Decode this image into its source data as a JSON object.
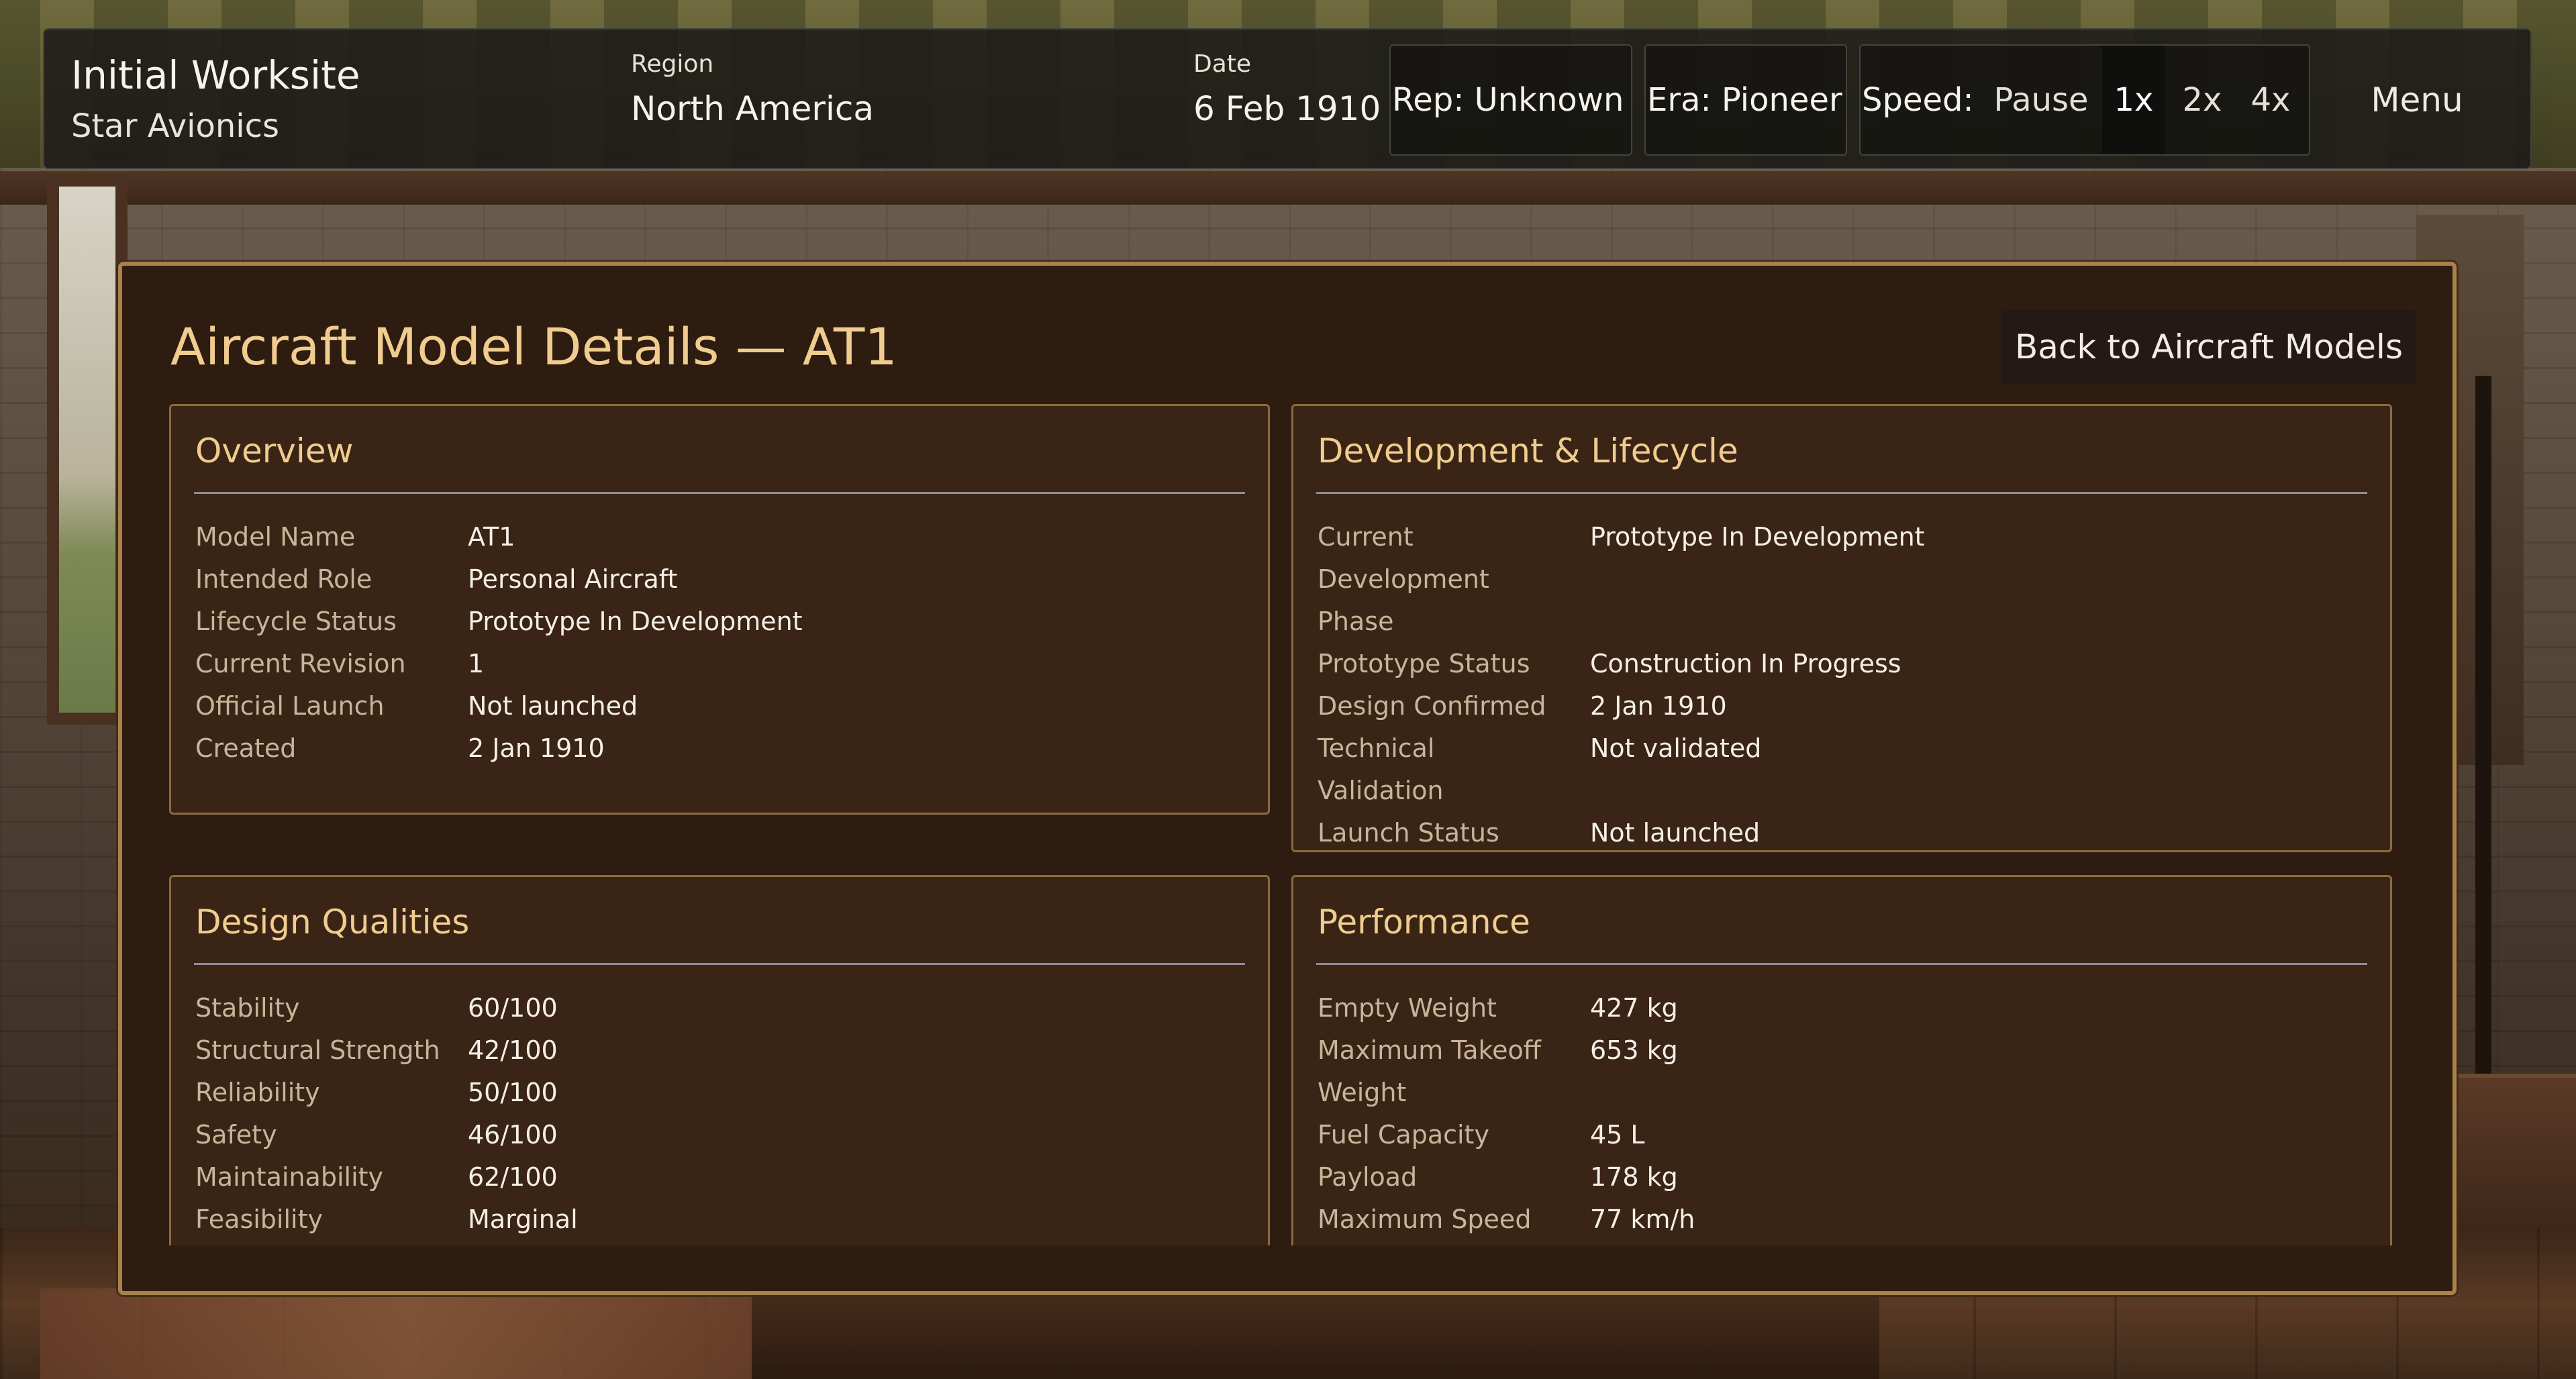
{
  "hud": {
    "company_title": "Initial Worksite",
    "company_sub": "Star Avionics",
    "region_label": "Region",
    "region_value": "North America",
    "date_label": "Date",
    "date_value": "6 Feb 1910",
    "rep": "Rep: Unknown",
    "era": "Era: Pioneer",
    "speed_label": "Speed:",
    "speed_options": [
      "Pause",
      "1x",
      "2x",
      "4x"
    ],
    "speed_active": "1x",
    "menu": "Menu"
  },
  "panel": {
    "title": "Aircraft Model Details — AT1",
    "back_button": "Back to Aircraft Models"
  },
  "cards": {
    "overview": {
      "title": "Overview",
      "rows": [
        {
          "k": "Model Name",
          "v": "AT1"
        },
        {
          "k": "Intended Role",
          "v": "Personal Aircraft"
        },
        {
          "k": "Lifecycle Status",
          "v": "Prototype In Development"
        },
        {
          "k": "Current Revision",
          "v": "1"
        },
        {
          "k": "Official Launch",
          "v": "Not launched"
        },
        {
          "k": "Created",
          "v": "2 Jan 1910"
        }
      ]
    },
    "development": {
      "title": "Development & Lifecycle",
      "rows": [
        {
          "k": "Current Development Phase",
          "v": "Prototype In Development"
        },
        {
          "k": "Prototype Status",
          "v": "Construction In Progress"
        },
        {
          "k": "Design Confirmed",
          "v": "2 Jan 1910"
        },
        {
          "k": "Technical Validation",
          "v": "Not validated"
        },
        {
          "k": "Launch Status",
          "v": "Not launched"
        }
      ]
    },
    "design": {
      "title": "Design Qualities",
      "rows": [
        {
          "k": "Stability",
          "v": "60/100"
        },
        {
          "k": "Structural Strength",
          "v": "42/100"
        },
        {
          "k": "Reliability",
          "v": "50/100"
        },
        {
          "k": "Safety",
          "v": "46/100"
        },
        {
          "k": "Maintainability",
          "v": "62/100"
        },
        {
          "k": "Feasibility",
          "v": "Marginal"
        }
      ]
    },
    "performance": {
      "title": "Performance",
      "rows": [
        {
          "k": "Empty Weight",
          "v": "427 kg"
        },
        {
          "k": "Maximum Takeoff Weight",
          "v": "653 kg"
        },
        {
          "k": "Fuel Capacity",
          "v": "45 L"
        },
        {
          "k": "Payload",
          "v": "178 kg"
        },
        {
          "k": "Maximum Speed",
          "v": "77 km/h"
        }
      ]
    }
  }
}
